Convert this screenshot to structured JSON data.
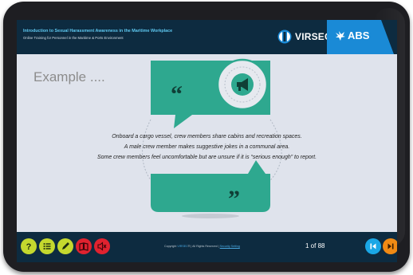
{
  "header": {
    "course_title": "Introduction to Sexual Harassment Awareness in the Maritime Workplace",
    "course_subtitle": "Online Training for Personnel in the Maritime & Ports Environment",
    "virsec_logo_text": "VIRSEC",
    "abs_logo_text": "ABS"
  },
  "slide": {
    "heading": "Example ....",
    "lines": [
      "Onboard a cargo vessel, crew members share cabins and recreation spaces.",
      "A male crew member makes suggestive jokes in a communal area.",
      "Some crew members feel uncomfortable but are unsure if it is “serious enough” to report."
    ]
  },
  "footer": {
    "copyright_prefix": "Copyright",
    "copyright_brand": "VIRSEC",
    "copyright_middle": "® | All Rights Reserved |",
    "security_link": "Security Setting",
    "page_counter": "1 of 88",
    "controls": [
      {
        "name": "help",
        "icon": "question-mark-icon",
        "color": "#c4d82e"
      },
      {
        "name": "menu",
        "icon": "list-icon",
        "color": "#c4d82e"
      },
      {
        "name": "notes",
        "icon": "pencil-icon",
        "color": "#c4d82e"
      },
      {
        "name": "glossary",
        "icon": "book-icon",
        "color": "#e0222f"
      },
      {
        "name": "audio",
        "icon": "speaker-muted-icon",
        "color": "#e0222f"
      }
    ],
    "nav": [
      {
        "name": "previous",
        "icon": "skip-back-icon",
        "color": "#1aa7e6"
      },
      {
        "name": "next",
        "icon": "skip-forward-icon",
        "color": "#f08a14"
      }
    ]
  },
  "colors": {
    "header_bg": "#0d2b40",
    "accent_blue": "#1a8ad6",
    "bubble_teal": "#2ea88f",
    "slide_bg": "#dfe3ec"
  }
}
